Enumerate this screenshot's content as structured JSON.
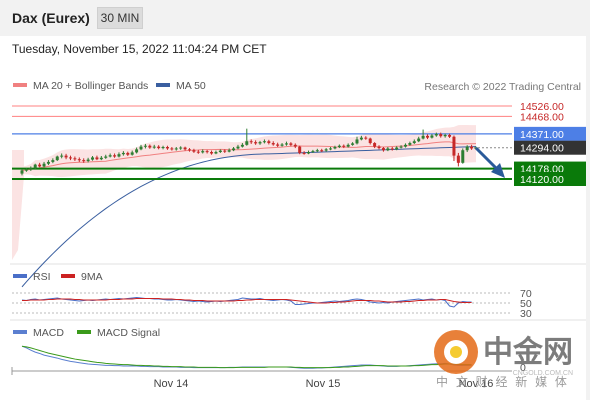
{
  "header": {
    "title": "Dax (Eurex)",
    "timeframe": "30 MIN"
  },
  "timestamp": "Tuesday, November 15, 2022 11:04:24 PM CET",
  "credit": "Research © 2022 Trading Central",
  "legend": {
    "ma20": "MA 20 + Bollinger Bands",
    "ma50": "MA 50",
    "rsi": "RSI",
    "rsi_ma": "9MA",
    "macd": "MACD",
    "macd_signal": "MACD Signal"
  },
  "colors": {
    "ma20": "#f08080",
    "ma50": "#3a5fa0",
    "rsi": "#4a6fc8",
    "rsi_ma": "#cc2222",
    "macd": "#5b7fd0",
    "macd_signal": "#3a9a1a",
    "up": "#2e7d32",
    "down": "#c62828",
    "support": "#0a7a0a",
    "resistance_line": "#ff8080",
    "pivot": "#4d7fe6",
    "arrow": "#2a5a9a"
  },
  "watermark": {
    "name": "中金网",
    "sub": "中 文 财 经 新 媒 体",
    "url": "CNGOLD.COM.CN"
  },
  "chart_data": [
    {
      "type": "candlestick",
      "title": "Dax (Eurex)",
      "timeframe": "30 MIN",
      "ylim": [
        13400,
        14600
      ],
      "x_ticks": [
        "Nov 14",
        "Nov 15",
        "Nov 16"
      ],
      "levels": [
        {
          "label": "14526.00",
          "value": 14526,
          "role": "resistance"
        },
        {
          "label": "14468.00",
          "value": 14468,
          "role": "resistance"
        },
        {
          "label": "14371.00",
          "value": 14371,
          "role": "pivot"
        },
        {
          "label": "14294.00",
          "value": 14294,
          "role": "last"
        },
        {
          "label": "14178.00",
          "value": 14178,
          "role": "support"
        },
        {
          "label": "14120.00",
          "value": 14120,
          "role": "support"
        }
      ],
      "candles": [
        [
          14150,
          14168,
          14140,
          14175
        ],
        [
          14168,
          14172,
          14160,
          14180
        ],
        [
          14172,
          14180,
          14165,
          14190
        ],
        [
          14180,
          14200,
          14175,
          14205
        ],
        [
          14200,
          14190,
          14185,
          14210
        ],
        [
          14190,
          14205,
          14185,
          14215
        ],
        [
          14205,
          14215,
          14198,
          14225
        ],
        [
          14215,
          14225,
          14208,
          14235
        ],
        [
          14225,
          14245,
          14220,
          14250
        ],
        [
          14245,
          14250,
          14235,
          14262
        ],
        [
          14250,
          14240,
          14230,
          14260
        ],
        [
          14240,
          14235,
          14225,
          14250
        ],
        [
          14235,
          14230,
          14220,
          14245
        ],
        [
          14230,
          14225,
          14215,
          14240
        ],
        [
          14225,
          14220,
          14210,
          14235
        ],
        [
          14220,
          14228,
          14212,
          14238
        ],
        [
          14228,
          14240,
          14222,
          14248
        ],
        [
          14240,
          14230,
          14225,
          14250
        ],
        [
          14230,
          14238,
          14225,
          14248
        ],
        [
          14238,
          14245,
          14232,
          14255
        ],
        [
          14245,
          14252,
          14240,
          14262
        ],
        [
          14252,
          14245,
          14238,
          14262
        ],
        [
          14245,
          14258,
          14240,
          14268
        ],
        [
          14258,
          14265,
          14250,
          14275
        ],
        [
          14265,
          14255,
          14248,
          14272
        ],
        [
          14255,
          14268,
          14250,
          14278
        ],
        [
          14268,
          14285,
          14262,
          14295
        ],
        [
          14285,
          14300,
          14280,
          14310
        ],
        [
          14300,
          14305,
          14290,
          14315
        ],
        [
          14305,
          14295,
          14288,
          14312
        ],
        [
          14295,
          14300,
          14288,
          14310
        ],
        [
          14300,
          14292,
          14285,
          14308
        ],
        [
          14292,
          14298,
          14285,
          14305
        ],
        [
          14298,
          14290,
          14282,
          14305
        ],
        [
          14290,
          14285,
          14278,
          14298
        ],
        [
          14285,
          14290,
          14278,
          14298
        ],
        [
          14290,
          14295,
          14282,
          14302
        ],
        [
          14295,
          14285,
          14278,
          14300
        ],
        [
          14285,
          14280,
          14272,
          14292
        ],
        [
          14280,
          14272,
          14265,
          14288
        ],
        [
          14272,
          14268,
          14260,
          14282
        ],
        [
          14268,
          14275,
          14262,
          14285
        ],
        [
          14275,
          14270,
          14262,
          14282
        ],
        [
          14270,
          14262,
          14255,
          14278
        ],
        [
          14262,
          14270,
          14258,
          14278
        ],
        [
          14270,
          14278,
          14265,
          14285
        ],
        [
          14278,
          14272,
          14265,
          14285
        ],
        [
          14272,
          14280,
          14268,
          14290
        ],
        [
          14280,
          14290,
          14275,
          14298
        ],
        [
          14290,
          14300,
          14285,
          14310
        ],
        [
          14300,
          14310,
          14295,
          14320
        ],
        [
          14310,
          14330,
          14305,
          14400
        ],
        [
          14330,
          14325,
          14315,
          14340
        ],
        [
          14325,
          14318,
          14310,
          14335
        ],
        [
          14318,
          14325,
          14310,
          14332
        ],
        [
          14325,
          14330,
          14318,
          14340
        ],
        [
          14330,
          14320,
          14312,
          14338
        ],
        [
          14320,
          14312,
          14305,
          14330
        ],
        [
          14312,
          14305,
          14298,
          14322
        ],
        [
          14305,
          14312,
          14300,
          14320
        ],
        [
          14312,
          14318,
          14305,
          14328
        ],
        [
          14318,
          14310,
          14302,
          14325
        ],
        [
          14310,
          14300,
          14292,
          14318
        ],
        [
          14300,
          14265,
          14258,
          14305
        ],
        [
          14265,
          14262,
          14255,
          14275
        ],
        [
          14262,
          14270,
          14258,
          14278
        ],
        [
          14270,
          14275,
          14265,
          14282
        ],
        [
          14275,
          14280,
          14270,
          14288
        ],
        [
          14280,
          14278,
          14270,
          14288
        ],
        [
          14278,
          14285,
          14272,
          14292
        ],
        [
          14285,
          14290,
          14280,
          14298
        ],
        [
          14290,
          14298,
          14285,
          14305
        ],
        [
          14298,
          14305,
          14292,
          14312
        ],
        [
          14305,
          14300,
          14292,
          14312
        ],
        [
          14300,
          14310,
          14295,
          14318
        ],
        [
          14310,
          14318,
          14305,
          14325
        ],
        [
          14318,
          14340,
          14312,
          14355
        ],
        [
          14340,
          14350,
          14335,
          14360
        ],
        [
          14350,
          14345,
          14338,
          14358
        ],
        [
          14345,
          14320,
          14312,
          14350
        ],
        [
          14320,
          14300,
          14292,
          14325
        ],
        [
          14300,
          14292,
          14285,
          14308
        ],
        [
          14292,
          14280,
          14272,
          14298
        ],
        [
          14280,
          14290,
          14275,
          14298
        ],
        [
          14290,
          14285,
          14278,
          14298
        ],
        [
          14285,
          14295,
          14280,
          14302
        ],
        [
          14295,
          14300,
          14290,
          14308
        ],
        [
          14300,
          14310,
          14295,
          14318
        ],
        [
          14310,
          14320,
          14305,
          14328
        ],
        [
          14320,
          14330,
          14315,
          14340
        ],
        [
          14330,
          14345,
          14325,
          14355
        ],
        [
          14345,
          14360,
          14340,
          14395
        ],
        [
          14360,
          14350,
          14342,
          14368
        ],
        [
          14350,
          14362,
          14345,
          14370
        ],
        [
          14362,
          14370,
          14355,
          14378
        ],
        [
          14370,
          14358,
          14350,
          14378
        ],
        [
          14358,
          14365,
          14350,
          14372
        ],
        [
          14365,
          14355,
          14348,
          14372
        ],
        [
          14355,
          14250,
          14220,
          14362
        ],
        [
          14250,
          14210,
          14190,
          14265
        ],
        [
          14210,
          14280,
          14205,
          14290
        ],
        [
          14280,
          14300,
          14270,
          14308
        ],
        [
          14300,
          14290,
          14282,
          14310
        ],
        [
          14290,
          14294,
          14285,
          14300
        ]
      ]
    },
    {
      "type": "line",
      "title": "RSI",
      "ylim": [
        20,
        80
      ],
      "y_ticks": [
        70,
        50,
        30
      ],
      "series": [
        {
          "name": "RSI",
          "values": [
            56,
            55,
            57,
            58,
            56,
            57,
            58,
            59,
            60,
            58,
            57,
            56,
            55,
            54,
            55,
            56,
            55,
            56,
            57,
            58,
            57,
            58,
            59,
            58,
            59,
            60,
            61,
            60,
            59,
            59,
            58,
            58,
            57,
            56,
            56,
            57,
            56,
            55,
            54,
            53,
            54,
            53,
            52,
            53,
            54,
            53,
            54,
            55,
            56,
            57,
            60,
            59,
            58,
            58,
            59,
            57,
            56,
            55,
            56,
            57,
            56,
            54,
            47,
            47,
            48,
            49,
            50,
            50,
            51,
            52,
            53,
            54,
            53,
            54,
            55,
            57,
            58,
            57,
            55,
            52,
            51,
            50,
            51,
            50,
            52,
            53,
            54,
            55,
            56,
            57,
            58,
            56,
            57,
            58,
            56,
            57,
            55,
            44,
            42,
            50,
            53,
            52,
            52
          ]
        },
        {
          "name": "9MA",
          "values": [
            55,
            55,
            56,
            56,
            56,
            56,
            57,
            57,
            58,
            58,
            58,
            58,
            57,
            57,
            56,
            56,
            56,
            56,
            56,
            56,
            57,
            57,
            57,
            58,
            58,
            58,
            59,
            59,
            59,
            59,
            59,
            59,
            58,
            58,
            58,
            57,
            57,
            56,
            56,
            55,
            55,
            55,
            54,
            54,
            54,
            54,
            54,
            54,
            54,
            55,
            55,
            56,
            56,
            57,
            57,
            57,
            57,
            57,
            57,
            57,
            57,
            56,
            55,
            54,
            53,
            52,
            51,
            50,
            50,
            50,
            51,
            51,
            52,
            52,
            53,
            54,
            55,
            55,
            55,
            55,
            54,
            54,
            53,
            52,
            52,
            52,
            52,
            53,
            53,
            54,
            55,
            55,
            56,
            56,
            56,
            57,
            57,
            55,
            53,
            52,
            51,
            51,
            51
          ]
        }
      ]
    },
    {
      "type": "line",
      "title": "MACD",
      "series": [
        {
          "name": "MACD",
          "values": [
            60,
            55,
            48,
            42,
            38,
            33,
            30,
            27,
            24,
            20,
            17,
            14,
            12,
            10,
            8,
            6,
            5,
            4,
            3,
            2,
            2,
            1,
            1,
            0,
            0,
            0,
            0,
            -1,
            -1,
            -2,
            -2,
            -2,
            -3,
            -3,
            -3,
            -3,
            -4,
            -4,
            -4,
            -5,
            -5,
            -5,
            -5,
            -5,
            -5,
            -5,
            -5,
            -4,
            -4,
            -4,
            -3,
            -3,
            -3,
            -3,
            -3,
            -3,
            -3,
            -3,
            -3,
            -3,
            -3,
            -4,
            -5,
            -6,
            -7,
            -7,
            -7,
            -6,
            -6,
            -5,
            -4,
            -3,
            -2,
            -1,
            0,
            1,
            2,
            3,
            3,
            3,
            2,
            1,
            0,
            -1,
            -1,
            -1,
            0,
            0,
            1,
            2,
            3,
            4,
            5,
            6,
            7,
            7,
            8,
            6,
            3,
            2,
            2,
            2,
            2
          ]
        },
        {
          "name": "MACD Signal",
          "values": [
            60,
            58,
            55,
            51,
            47,
            43,
            39,
            36,
            33,
            30,
            27,
            24,
            21,
            19,
            17,
            15,
            13,
            11,
            10,
            8,
            7,
            6,
            5,
            4,
            4,
            3,
            2,
            2,
            1,
            1,
            0,
            0,
            -1,
            -1,
            -2,
            -2,
            -2,
            -3,
            -3,
            -3,
            -4,
            -4,
            -4,
            -4,
            -4,
            -5,
            -5,
            -5,
            -5,
            -4,
            -4,
            -4,
            -4,
            -4,
            -4,
            -4,
            -3,
            -3,
            -3,
            -3,
            -3,
            -3,
            -4,
            -4,
            -5,
            -5,
            -5,
            -5,
            -5,
            -5,
            -5,
            -4,
            -4,
            -3,
            -3,
            -2,
            -1,
            0,
            1,
            1,
            1,
            1,
            1,
            0,
            0,
            0,
            0,
            0,
            0,
            1,
            1,
            2,
            3,
            4,
            4,
            5,
            6,
            6,
            6,
            5,
            4,
            4,
            4
          ]
        }
      ]
    }
  ]
}
